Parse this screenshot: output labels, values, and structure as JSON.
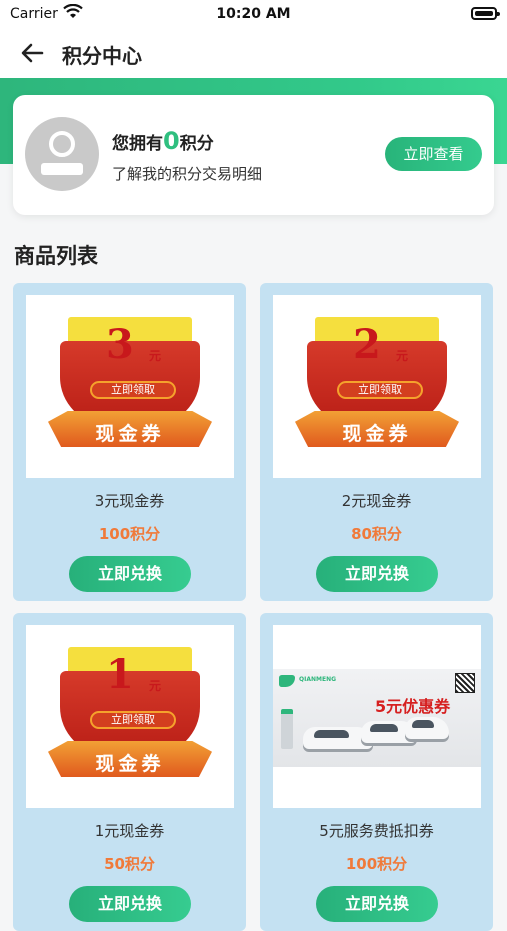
{
  "status_bar": {
    "carrier": "Carrier",
    "time": "10:20 AM"
  },
  "nav": {
    "title": "积分中心"
  },
  "points_card": {
    "prefix": "您拥有",
    "points": "0",
    "suffix": "积分",
    "subtitle": "了解我的积分交易明细",
    "button": "立即查看"
  },
  "section_title": "商品列表",
  "products": [
    {
      "name": "3元现金券",
      "price": "100积分",
      "button": "立即兑换",
      "art": {
        "number": "3",
        "unit": "元",
        "pill": "立即领取",
        "ribbon": "现金券"
      }
    },
    {
      "name": "2元现金券",
      "price": "80积分",
      "button": "立即兑换",
      "art": {
        "number": "2",
        "unit": "元",
        "pill": "立即领取",
        "ribbon": "现金券"
      }
    },
    {
      "name": "1元现金券",
      "price": "50积分",
      "button": "立即兑换",
      "art": {
        "number": "1",
        "unit": "元",
        "pill": "立即领取",
        "ribbon": "现金券"
      }
    },
    {
      "name": "5元服务费抵扣券",
      "price": "100积分",
      "button": "立即兑换",
      "art": {
        "brand": "QIANMENG",
        "text": "5元优惠券"
      }
    }
  ],
  "colors": {
    "accent": "#2fbf7f",
    "price": "#f07a3a",
    "card_bg": "#c4e1f2"
  }
}
